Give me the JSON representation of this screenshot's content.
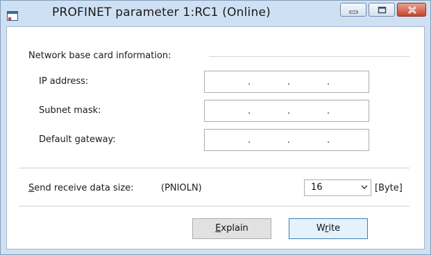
{
  "window": {
    "title": "PROFINET parameter 1:RC1 (Online)",
    "controls": {
      "minimize": "minimize-icon",
      "maximize": "maximize-icon",
      "close": "close-icon"
    }
  },
  "group": {
    "title": "Network base card information:",
    "fields": [
      {
        "label": "IP address:",
        "value": "",
        "dots": "."
      },
      {
        "label": "Subnet mask:",
        "value": "",
        "dots": "."
      },
      {
        "label": "Default gateway:",
        "value": "",
        "dots": "."
      }
    ]
  },
  "data_size": {
    "label_accel": "S",
    "label_rest": "end receive data size:",
    "param": "(PNIOLN)",
    "selected": "16",
    "unit": "[Byte]"
  },
  "buttons": {
    "explain_accel": "E",
    "explain_rest": "xplain",
    "write_pre": "W",
    "write_accel": "r",
    "write_rest": "ite"
  },
  "colors": {
    "titlebar": "#cfe0f3",
    "close_button": "#c7452d",
    "client_bg": "#ffffff"
  }
}
